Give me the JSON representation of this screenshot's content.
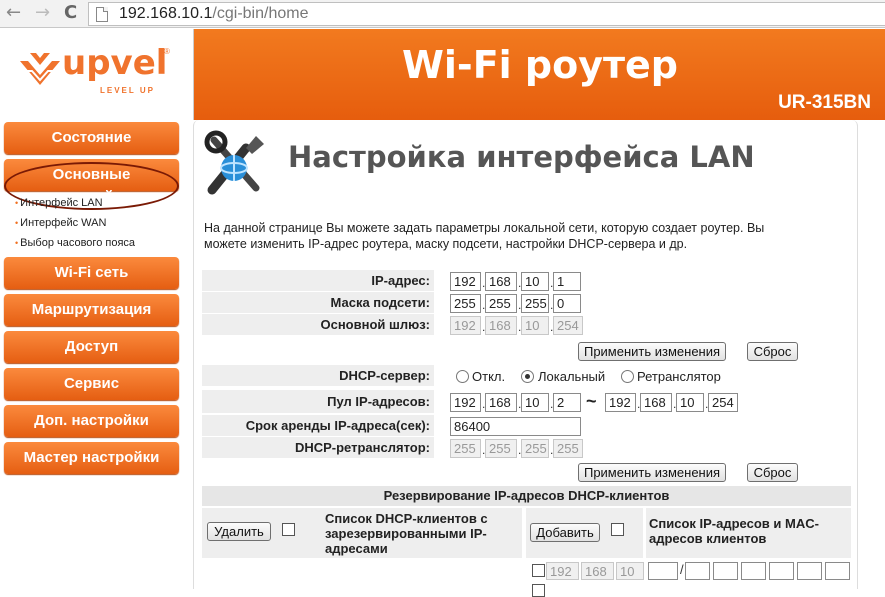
{
  "browser": {
    "url_host": "192.168.10.1",
    "url_path": "/cgi-bin/home",
    "back_glyph": "←",
    "forward_glyph": "→",
    "reload_glyph": "C"
  },
  "brand": {
    "logo_text": "upvel",
    "tagline": "LEVEL UP",
    "registered": "®",
    "accent": "#f0732d"
  },
  "header": {
    "title": "Wi-Fi роутер",
    "model": "UR-315BN"
  },
  "sidebar": {
    "items": [
      {
        "label": "Состояние"
      },
      {
        "label": "Основные настройки"
      },
      {
        "label": "Wi-Fi сеть"
      },
      {
        "label": "Маршрутизация"
      },
      {
        "label": "Доступ"
      },
      {
        "label": "Сервис"
      },
      {
        "label": "Доп. настройки"
      },
      {
        "label": "Мастер настройки"
      }
    ],
    "subitems": [
      {
        "label": "Интерфейс LAN"
      },
      {
        "label": "Интерфейс WAN"
      },
      {
        "label": "Выбор часового пояса"
      }
    ]
  },
  "page": {
    "title": "Настройка интерфейса LAN",
    "description": "На данной странице Вы можете задать параметры локальной сети, которую создает роутер. Вы можете изменить IP-адрес роутера, маску подсети, настройки DHCP-сервера и др."
  },
  "lan": {
    "ip_label": "IP-адрес:",
    "ip": [
      "192",
      "168",
      "10",
      "1"
    ],
    "mask_label": "Маска подсети:",
    "mask": [
      "255",
      "255",
      "255",
      "0"
    ],
    "gateway_label": "Основной шлюз:",
    "gateway": [
      "192",
      "168",
      "10",
      "254"
    ],
    "apply_label": "Применить изменения",
    "reset_label": "Сброс"
  },
  "dhcp": {
    "server_label": "DHCP-сервер:",
    "options": [
      "Откл.",
      "Локальный",
      "Ретранслятор"
    ],
    "selected": "Локальный",
    "pool_label": "Пул IP-адресов:",
    "pool_start": [
      "192",
      "168",
      "10",
      "2"
    ],
    "pool_sep": "~",
    "pool_end": [
      "192",
      "168",
      "10",
      "254"
    ],
    "lease_label": "Срок аренды IP-адреса(сек):",
    "lease_value": "86400",
    "relay_label": "DHCP-ретранслятор:",
    "relay": [
      "255",
      "255",
      "255",
      "255"
    ],
    "apply_label": "Применить изменения",
    "reset_label": "Сброс"
  },
  "reservation": {
    "title": "Резервирование IP-адресов DHCP-клиентов",
    "delete_label": "Удалить",
    "reserved_list_label": "Список DHCP-клиентов с зарезервированными IP-адресами",
    "add_label": "Добавить",
    "clients_list_label": "Список IP-адресов и MAC-адресов клиентов",
    "new_entry_ip": [
      "192",
      "168",
      "10",
      ""
    ],
    "mac_sep": "/"
  }
}
